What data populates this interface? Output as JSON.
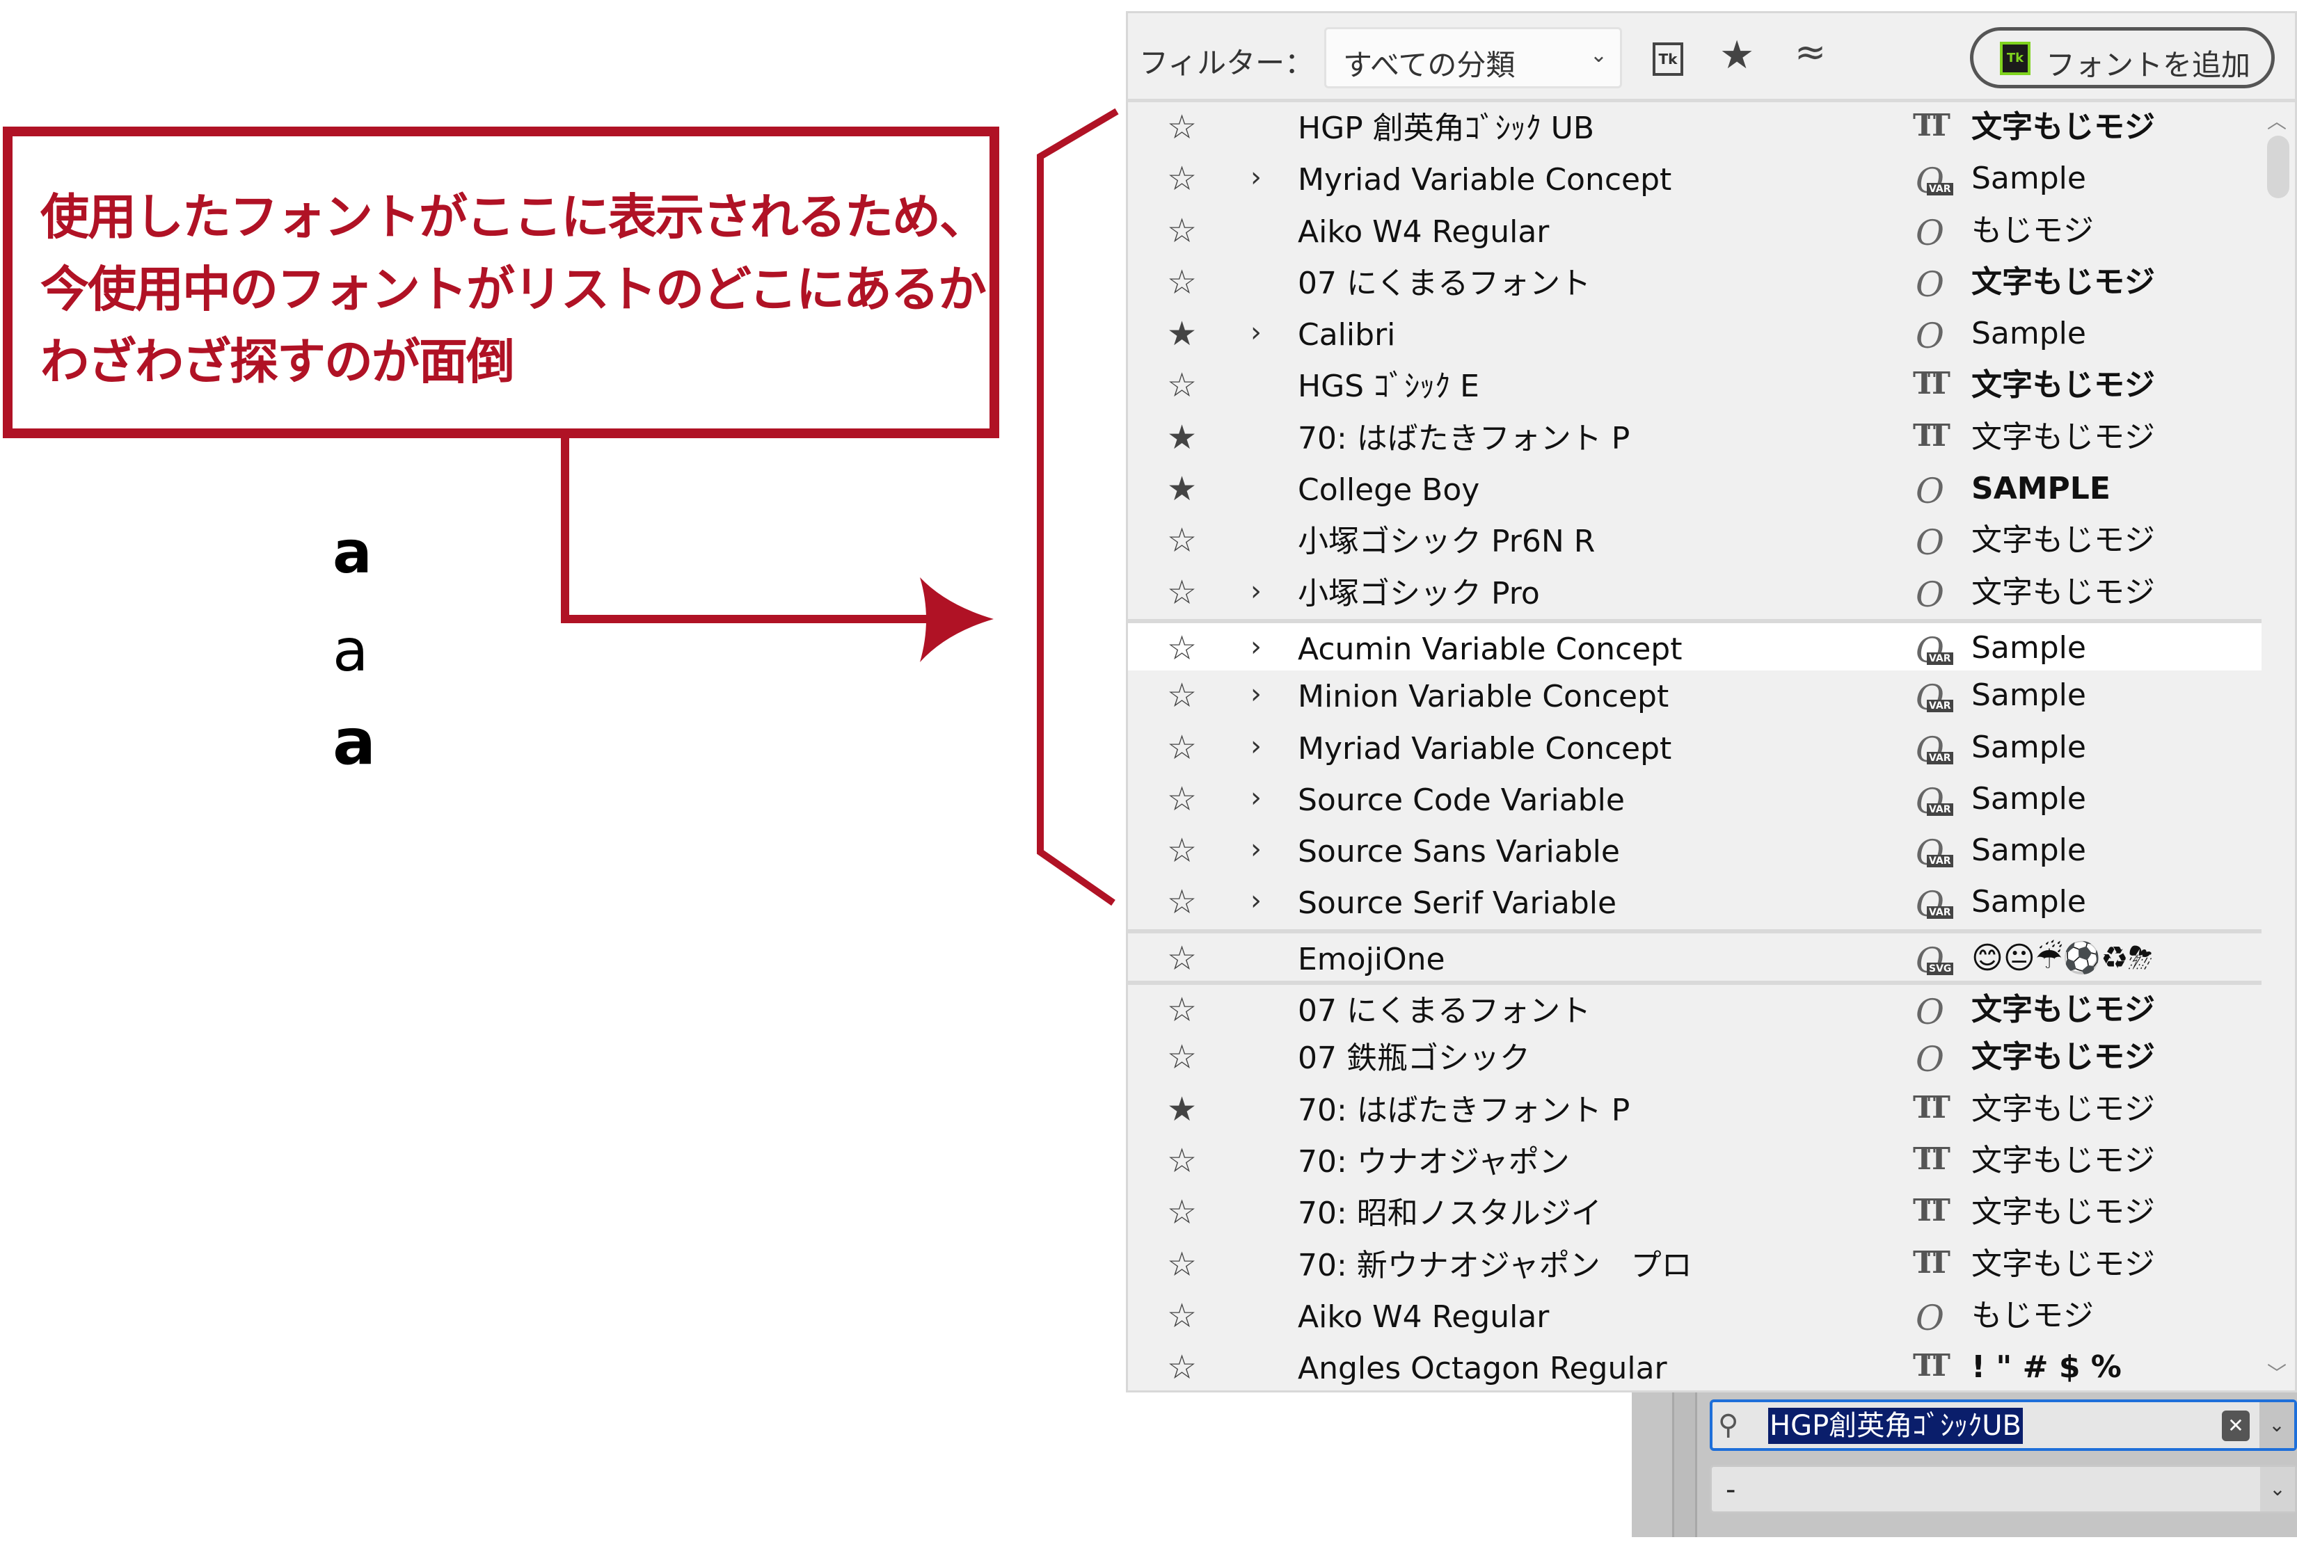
{
  "annotation": {
    "lines": [
      "使用したフォントがここに表示されるため、",
      "今使用中のフォントがリストのどこにあるか",
      "わざわざ探すのが面倒"
    ],
    "accent_color": "#b01225"
  },
  "sample_letters": [
    "a",
    "a",
    "a"
  ],
  "panel": {
    "filter_label": "フィルター：",
    "filter_value": "すべての分類",
    "typekit_filter_icon": "Tk",
    "add_font_button": "フォントを追加",
    "add_font_icon": "Tk",
    "rows": [
      {
        "starred": false,
        "expandable": false,
        "name": "HGP 創英角ｺﾞｼｯｸ UB",
        "type": "truetype",
        "sample": "文字もじモジ",
        "bold": true
      },
      {
        "starred": false,
        "expandable": true,
        "name": "Myriad Variable Concept",
        "type": "opentype-var",
        "sample": "Sample",
        "bold": false
      },
      {
        "starred": false,
        "expandable": false,
        "name": "Aiko W4 Regular",
        "type": "opentype",
        "sample": "もじモジ",
        "bold": false
      },
      {
        "starred": false,
        "expandable": false,
        "name": "07 にくまるフォント",
        "type": "opentype",
        "sample": "文字もじモジ",
        "bold": true
      },
      {
        "starred": true,
        "expandable": true,
        "name": "Calibri",
        "type": "opentype",
        "sample": "Sample",
        "bold": false
      },
      {
        "starred": false,
        "expandable": false,
        "name": "HGS ｺﾞｼｯｸ E",
        "type": "truetype",
        "sample": "文字もじモジ",
        "bold": true
      },
      {
        "starred": true,
        "expandable": false,
        "name": "70: はばたきフォント P",
        "type": "truetype",
        "sample": "文字もじモジ",
        "bold": false
      },
      {
        "starred": true,
        "expandable": false,
        "name": "College Boy",
        "type": "opentype",
        "sample": "SAMPLE",
        "bold": true
      },
      {
        "starred": false,
        "expandable": false,
        "name": "小塚ゴシック Pr6N R",
        "type": "opentype",
        "sample": "文字もじモジ",
        "bold": false
      },
      {
        "starred": false,
        "expandable": true,
        "name": "小塚ゴシック Pro",
        "type": "opentype",
        "sample": "文字もじモジ",
        "bold": false
      },
      {
        "starred": false,
        "expandable": true,
        "name": "Acumin Variable Concept",
        "type": "opentype-var",
        "sample": "Sample",
        "bold": false,
        "section_start": true,
        "highlighted": true
      },
      {
        "starred": false,
        "expandable": true,
        "name": "Minion Variable Concept",
        "type": "opentype-var",
        "sample": "Sample",
        "bold": false
      },
      {
        "starred": false,
        "expandable": true,
        "name": "Myriad Variable Concept",
        "type": "opentype-var",
        "sample": "Sample",
        "bold": false
      },
      {
        "starred": false,
        "expandable": true,
        "name": "Source Code Variable",
        "type": "opentype-var",
        "sample": "Sample",
        "bold": false
      },
      {
        "starred": false,
        "expandable": true,
        "name": "Source Sans Variable",
        "type": "opentype-var",
        "sample": "Sample",
        "bold": false
      },
      {
        "starred": false,
        "expandable": true,
        "name": "Source Serif Variable",
        "type": "opentype-var",
        "sample": "Sample",
        "bold": false
      },
      {
        "starred": false,
        "expandable": false,
        "name": "EmojiOne",
        "type": "opentype-svg",
        "sample": "😊😐☔⚽♻⛈",
        "bold": false,
        "section_start": true
      },
      {
        "starred": false,
        "expandable": false,
        "name": "07 にくまるフォント",
        "type": "opentype",
        "sample": "文字もじモジ",
        "bold": true,
        "section_start": true
      },
      {
        "starred": false,
        "expandable": false,
        "name": "07 鉄瓶ゴシック",
        "type": "opentype",
        "sample": "文字もじモジ",
        "bold": true
      },
      {
        "starred": true,
        "expandable": false,
        "name": "70: はばたきフォント P",
        "type": "truetype",
        "sample": "文字もじモジ",
        "bold": false
      },
      {
        "starred": false,
        "expandable": false,
        "name": "70: ウナオジャポン",
        "type": "truetype",
        "sample": "文字もじモジ",
        "bold": false
      },
      {
        "starred": false,
        "expandable": false,
        "name": "70: 昭和ノスタルジイ",
        "type": "truetype",
        "sample": "文字もじモジ",
        "bold": false
      },
      {
        "starred": false,
        "expandable": false,
        "name": "70: 新ウナオジャポン　プロ",
        "type": "truetype",
        "sample": "文字もじモジ",
        "bold": false
      },
      {
        "starred": false,
        "expandable": false,
        "name": "Aiko W4 Regular",
        "type": "opentype",
        "sample": "もじモジ",
        "bold": false
      },
      {
        "starred": false,
        "expandable": false,
        "name": "Angles Octagon Regular",
        "type": "truetype",
        "sample": "! \" # $ %",
        "bold": true
      }
    ],
    "type_badges": {
      "opentype-var": "VAR",
      "opentype-svg": "SVG"
    }
  },
  "font_controls": {
    "font_name_value": "HGP創英角ｺﾞｼｯｸUB",
    "font_style_value": "-"
  }
}
